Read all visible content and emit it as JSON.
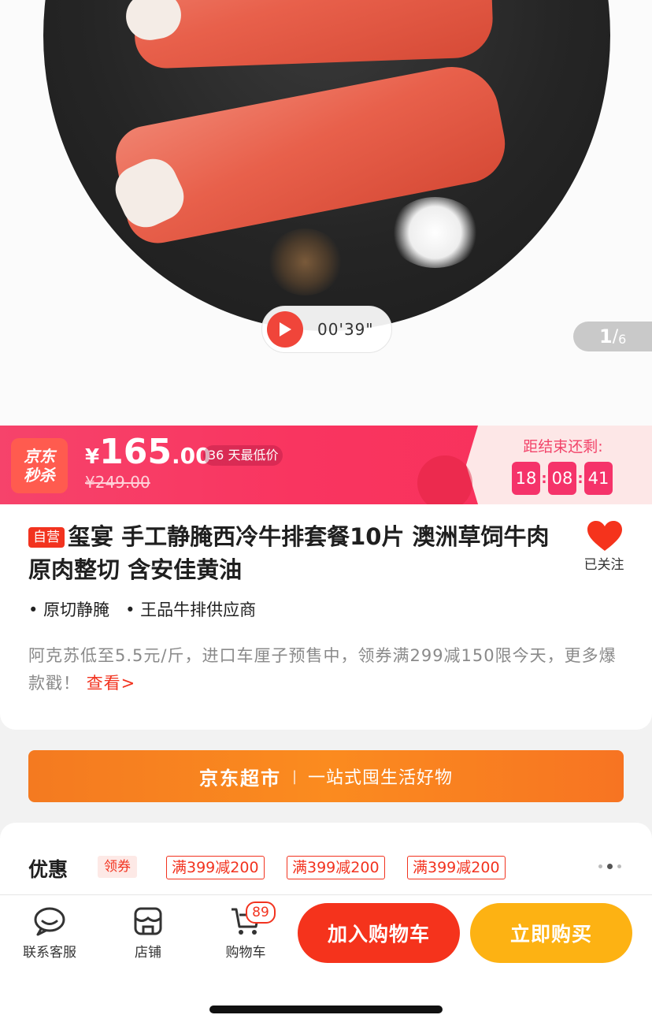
{
  "gallery": {
    "video_duration": "00'39\"",
    "page_current": "1",
    "page_separator": "/",
    "page_total": "6"
  },
  "flash_sale": {
    "logo_line1": "京东",
    "logo_line2": "秒杀",
    "currency": "¥",
    "price_int": "165",
    "price_dec": ".00",
    "lowest_badge": "36 天最低价",
    "original_price": "¥249.00",
    "countdown_label": "距结束还剩:",
    "countdown": {
      "hours": "18",
      "minutes": "08",
      "seconds": "41"
    }
  },
  "product": {
    "self_tag": "自营",
    "title": "玺宴 手工静腌西冷牛排套餐10片 澳洲草饲牛肉 原肉整切 含安佳黄油",
    "follow_label": "已关注",
    "features": [
      "• 原切静腌",
      "• 王品牛排供应商"
    ],
    "promo_text": "阿克苏低至5.5元/斤，进口车厘子预售中，领券满299减150限今天，更多爆款戳！",
    "promo_link": "查看>"
  },
  "banner": {
    "brand": "京东超市",
    "separator": "|",
    "slogan": "一站式囤生活好物"
  },
  "coupons": {
    "title": "优惠",
    "get_label": "领券",
    "items": [
      "满399减200",
      "满399减200",
      "满399减200"
    ]
  },
  "bottom_bar": {
    "service_label": "联系客服",
    "shop_label": "店铺",
    "cart_label": "购物车",
    "cart_count": "89",
    "add_to_cart": "加入购物车",
    "buy_now": "立即购买"
  },
  "colors": {
    "accent_red": "#f2331f",
    "flash_pink": "#f93560",
    "buy_yellow": "#fdb213",
    "banner_orange": "#fb8b1f"
  }
}
